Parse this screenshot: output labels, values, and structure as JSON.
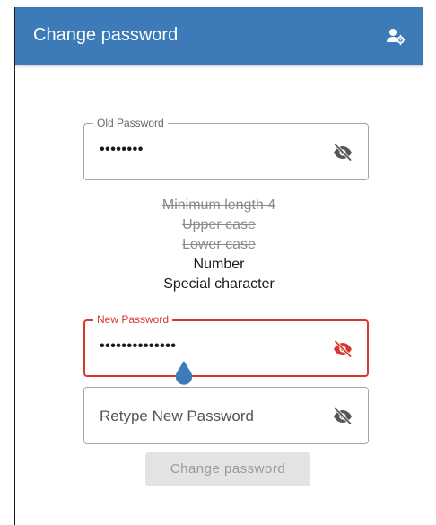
{
  "appbar": {
    "title": "Change password",
    "icon": "account-settings-icon",
    "color": "#3d7ab8"
  },
  "old_password": {
    "label": "Old Password",
    "value": "••••••••",
    "toggle_icon": "eye-off-icon"
  },
  "requirements": [
    {
      "text": "Minimum length 4",
      "met": true
    },
    {
      "text": "Upper case",
      "met": true
    },
    {
      "text": "Lower case",
      "met": true
    },
    {
      "text": "Number",
      "met": false
    },
    {
      "text": "Special character",
      "met": false
    }
  ],
  "new_password": {
    "label": "New Password",
    "value": "••••••••••••••",
    "toggle_icon": "eye-off-icon",
    "error_color": "#d9372c"
  },
  "retype_password": {
    "placeholder": "Retype New Password",
    "toggle_icon": "eye-off-icon"
  },
  "submit": {
    "label": "Change password",
    "disabled": true
  }
}
